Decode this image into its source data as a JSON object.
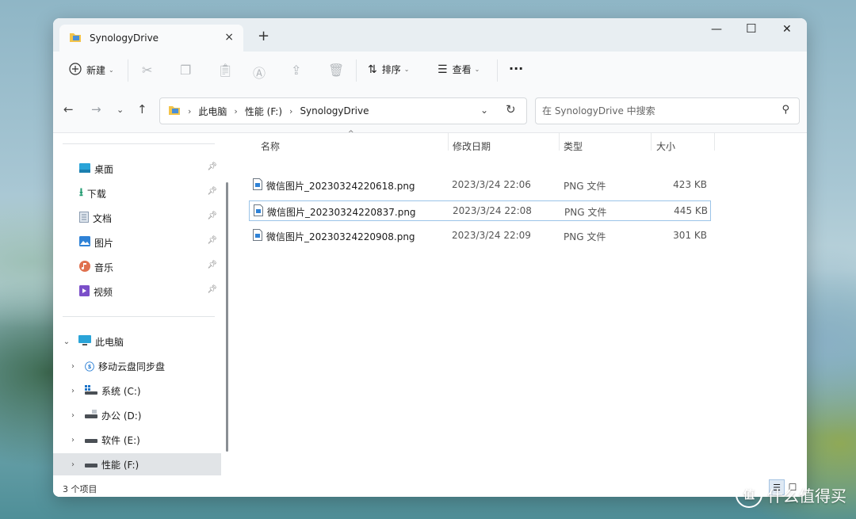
{
  "tab": {
    "title": "SynologyDrive",
    "close_icon": "×",
    "new_tab_icon": "+"
  },
  "window_controls": {
    "minimize": "—",
    "maximize": "☐",
    "close": "✕"
  },
  "toolbar": {
    "new_label": "新建",
    "sort_label": "排序",
    "view_label": "查看",
    "more_label": "···"
  },
  "address": {
    "crumbs": [
      "此电脑",
      "性能 (F:)",
      "SynologyDrive"
    ]
  },
  "search": {
    "placeholder": "在 SynologyDrive 中搜索"
  },
  "quick_access": [
    {
      "label": "桌面",
      "icon": "desktop-icon"
    },
    {
      "label": "下载",
      "icon": "download-icon"
    },
    {
      "label": "文档",
      "icon": "document-icon"
    },
    {
      "label": "图片",
      "icon": "pictures-icon"
    },
    {
      "label": "音乐",
      "icon": "music-icon"
    },
    {
      "label": "视频",
      "icon": "video-icon"
    }
  ],
  "tree": [
    {
      "label": "此电脑",
      "icon": "pc-icon",
      "expanded": true
    },
    {
      "label": "移动云盘同步盘",
      "icon": "cloud-drive-icon"
    },
    {
      "label": "系统 (C:)",
      "icon": "system-drive-icon"
    },
    {
      "label": "办公 (D:)",
      "icon": "drive-icon"
    },
    {
      "label": "软件 (E:)",
      "icon": "drive-icon"
    },
    {
      "label": "性能 (F:)",
      "icon": "drive-icon",
      "selected": true
    }
  ],
  "columns": {
    "name": "名称",
    "date": "修改日期",
    "type": "类型",
    "size": "大小"
  },
  "files": [
    {
      "name": "微信图片_20230324220618.png",
      "date": "2023/3/24 22:06",
      "type": "PNG 文件",
      "size": "423 KB"
    },
    {
      "name": "微信图片_20230324220837.png",
      "date": "2023/3/24 22:08",
      "type": "PNG 文件",
      "size": "445 KB"
    },
    {
      "name": "微信图片_20230324220908.png",
      "date": "2023/3/24 22:09",
      "type": "PNG 文件",
      "size": "301 KB"
    }
  ],
  "status": {
    "count": "3 个项目"
  },
  "watermark": {
    "text": "什么值得买",
    "badge": "值"
  },
  "colors": {
    "selection_border": "#9bc4e8",
    "accent": "#0067c0",
    "titlebar": "#e8eef2"
  }
}
